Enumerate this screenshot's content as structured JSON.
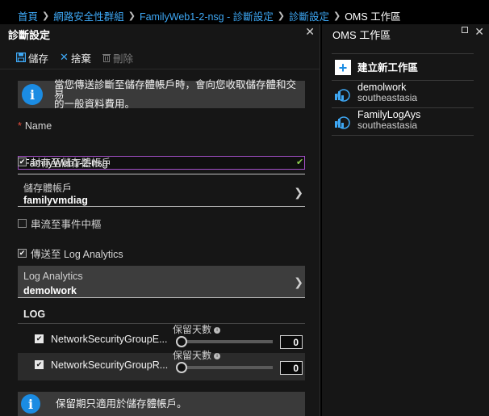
{
  "breadcrumb": {
    "items": [
      "首頁",
      "網路安全性群組",
      "FamilyWeb1-2-nsg - 診斷設定",
      "診斷設定"
    ],
    "current": "OMS 工作區"
  },
  "diagnostics_blade": {
    "title": "診斷設定",
    "toolbar": {
      "save_label": "儲存",
      "discard_label": "捨棄",
      "delete_label": "刪除"
    },
    "info_text_line1": "當您傳送診斷至儲存體帳戶時，會向您收取儲存體和交易",
    "info_text_line2": "的一般資料費用。",
    "name_label": "Name",
    "name_value": "FamilyWeb1-2-nsg",
    "archive_storage_label": "封存至儲存體帳戶",
    "archive_storage_checked": true,
    "storage_account_label": "儲存體帳戶",
    "storage_account_value": "familyvmdiag",
    "stream_event_hub_label": "串流至事件中樞",
    "stream_event_hub_checked": false,
    "send_log_analytics_label": "傳送至 Log Analytics",
    "send_log_analytics_checked": true,
    "log_analytics_label": "Log Analytics",
    "log_analytics_value": "demolwork",
    "log_section_title": "LOG",
    "logs": [
      {
        "name": "NetworkSecurityGroupE...",
        "retention_label": "保留天數",
        "retention_days": "0",
        "checked": true
      },
      {
        "name": "NetworkSecurityGroupR...",
        "retention_label": "保留天數",
        "retention_days": "0",
        "checked": true
      }
    ],
    "bottom_info_text": "保留期只適用於儲存體帳戶。"
  },
  "oms_blade": {
    "title": "OMS 工作區",
    "create_label": "建立新工作區",
    "workspaces": [
      {
        "name": "demolwork",
        "region": "southeastasia"
      },
      {
        "name": "FamilyLogAys",
        "region": "southeastasia"
      }
    ]
  },
  "colors": {
    "accent": "#3ea8f5",
    "info_blue": "#1b8ce3",
    "focus_border": "#a350c8",
    "valid": "#8fd14f"
  }
}
